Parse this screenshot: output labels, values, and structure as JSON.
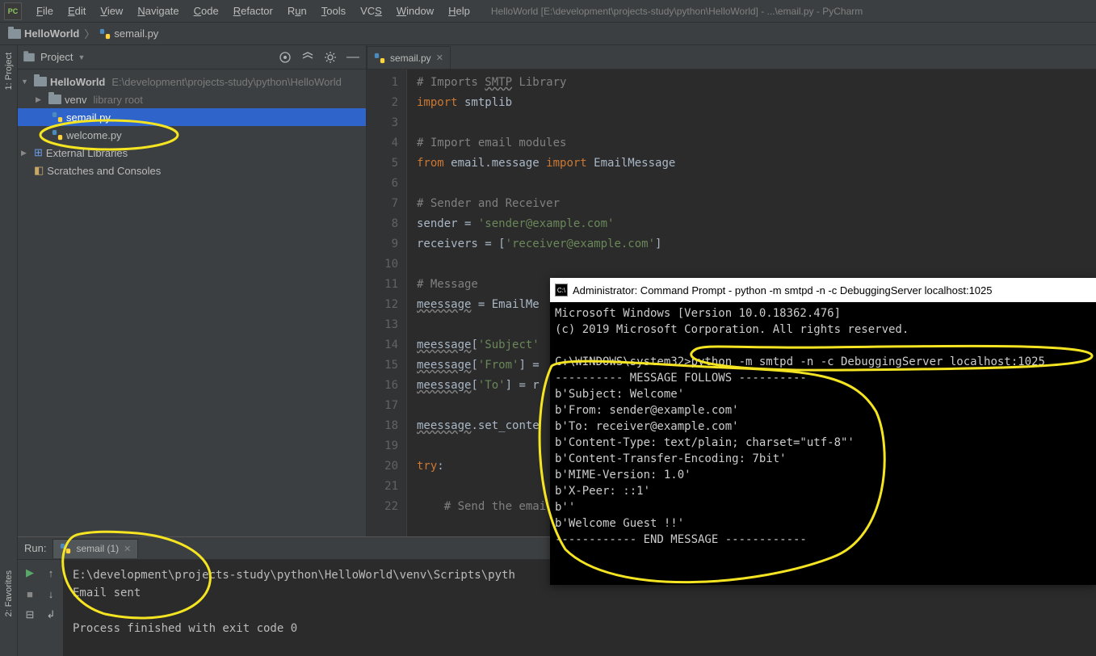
{
  "menubar": {
    "items": [
      {
        "label": "File",
        "key": "F"
      },
      {
        "label": "Edit",
        "key": "E"
      },
      {
        "label": "View",
        "key": "V"
      },
      {
        "label": "Navigate",
        "key": "N"
      },
      {
        "label": "Code",
        "key": "C"
      },
      {
        "label": "Refactor",
        "key": "R"
      },
      {
        "label": "Run",
        "key": "u"
      },
      {
        "label": "Tools",
        "key": "T"
      },
      {
        "label": "VCS",
        "key": "S"
      },
      {
        "label": "Window",
        "key": "W"
      },
      {
        "label": "Help",
        "key": "H"
      }
    ],
    "title": "HelloWorld [E:\\development\\projects-study\\python\\HelloWorld] - ...\\email.py - PyCharm"
  },
  "breadcrumb": {
    "project": "HelloWorld",
    "file": "semail.py"
  },
  "left_tabs": {
    "project": "1: Project",
    "favorites": "2: Favorites"
  },
  "project_panel": {
    "title": "Project",
    "tree": {
      "root": "HelloWorld",
      "root_path": "E:\\development\\projects-study\\python\\HelloWorld",
      "venv": "venv",
      "venv_hint": "library root",
      "files": [
        "semail.py",
        "welcome.py"
      ],
      "ext_libs": "External Libraries",
      "scratches": "Scratches and Consoles"
    }
  },
  "editor": {
    "tab": "semail.py",
    "lines": [
      "# Imports SMTP Library",
      "import smtplib",
      "",
      "# Import email modules",
      "from email.message import EmailMessage",
      "",
      "# Sender and Receiver",
      "sender = 'sender@example.com'",
      "receivers = ['receiver@example.com']",
      "",
      "# Message",
      "meessage = EmailMe",
      "",
      "meessage['Subject'",
      "meessage['From'] =",
      "meessage['To'] = r",
      "",
      "meessage.set_conte",
      "",
      "try:",
      "",
      "    # Send the emai"
    ]
  },
  "run": {
    "label": "Run:",
    "tab": "semail (1)",
    "output": [
      "E:\\development\\projects-study\\python\\HelloWorld\\venv\\Scripts\\pyth",
      "Email sent",
      "",
      "Process finished with exit code 0"
    ]
  },
  "cmd": {
    "title": "Administrator: Command Prompt - python  -m smtpd -n -c DebuggingServer localhost:1025",
    "lines": [
      "Microsoft Windows [Version 10.0.18362.476]",
      "(c) 2019 Microsoft Corporation. All rights reserved.",
      "",
      "C:\\WINDOWS\\system32>python -m smtpd -n -c DebuggingServer localhost:1025",
      "---------- MESSAGE FOLLOWS ----------",
      "b'Subject: Welcome'",
      "b'From: sender@example.com'",
      "b'To: receiver@example.com'",
      "b'Content-Type: text/plain; charset=\"utf-8\"'",
      "b'Content-Transfer-Encoding: 7bit'",
      "b'MIME-Version: 1.0'",
      "b'X-Peer: ::1'",
      "b''",
      "b'Welcome Guest !!'",
      "------------ END MESSAGE ------------"
    ]
  }
}
